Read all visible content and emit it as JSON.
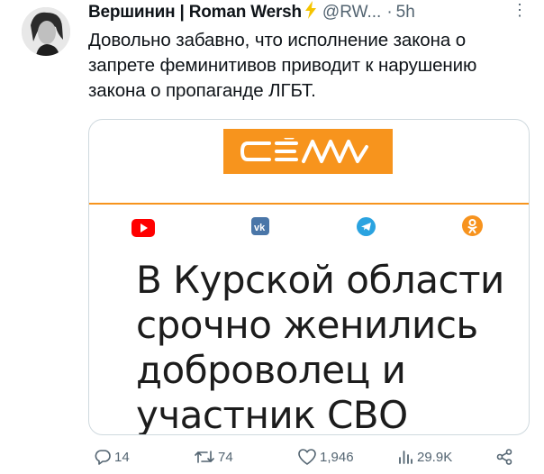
{
  "tweet": {
    "author_name": "Вершинин | Roman Wersh",
    "handle": "@RW...",
    "separator": "·",
    "time": "5h",
    "more": "⋮",
    "text": "Довольно забавно, что исполнение закона о запрете феминитивов приводит к нарушению закона о пропаганде ЛГБТ."
  },
  "card": {
    "headline": "В Курской области срочно женились доброволец и участник СВО",
    "logo_color": "#f7941d",
    "social_icons": [
      "youtube-icon",
      "vk-icon",
      "telegram-icon",
      "odnoklassniki-icon"
    ]
  },
  "actions": {
    "replies": "14",
    "retweets": "74",
    "likes": "1,946",
    "views": "29.9K"
  },
  "colors": {
    "text": "#0f1419",
    "secondary": "#536471",
    "verified": "#f5c400",
    "accent_orange": "#f7941d"
  }
}
